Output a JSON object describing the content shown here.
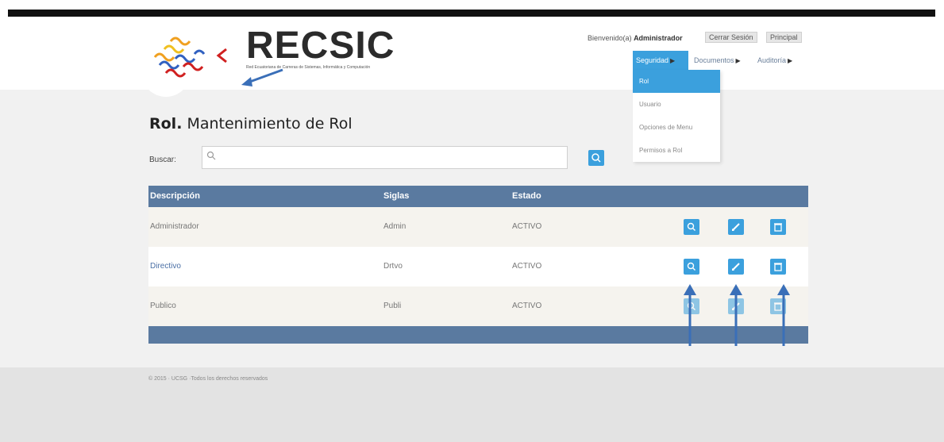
{
  "header": {
    "logo_title": "RECSIC",
    "logo_subtitle": "Red Ecuatoriana de Carreras de Sistemas, Informática y Computación",
    "welcome_text": "Bienvenido(a)",
    "user_name": "Administrador",
    "logout_label": "Cerrar Sesión",
    "home_label": "Principal"
  },
  "nav": {
    "items": [
      {
        "label": "Seguridad",
        "active": true
      },
      {
        "label": "Documentos",
        "active": false
      },
      {
        "label": "Auditoría",
        "active": false
      }
    ],
    "dropdown": [
      {
        "label": "Rol",
        "active": true
      },
      {
        "label": "Usuario",
        "active": false
      },
      {
        "label": "Opciones de Menu",
        "active": false
      },
      {
        "label": "Permisos a Rol",
        "active": false
      }
    ]
  },
  "page": {
    "title_bold": "Rol.",
    "title_rest": "Mantenimiento de Rol",
    "search_label": "Buscar:",
    "search_placeholder": ""
  },
  "table": {
    "columns": [
      "Descripción",
      "Siglas",
      "Estado"
    ],
    "rows": [
      {
        "descripcion": "Administrador",
        "siglas": "Admin",
        "estado": "ACTIVO"
      },
      {
        "descripcion": "Directivo",
        "siglas": "Drtvo",
        "estado": "ACTIVO"
      },
      {
        "descripcion": "Publico",
        "siglas": "Publi",
        "estado": "ACTIVO"
      }
    ]
  },
  "footer": {
    "text": "© 2015 · UCSG ·Todos los derechos reservados"
  },
  "colors": {
    "accent": "#3ba0dd",
    "table_header": "#5a7aa0",
    "annotation_arrow": "#3a6fb8"
  },
  "icons": {
    "search": "search-icon",
    "view": "view-icon",
    "edit": "edit-icon",
    "delete": "delete-icon",
    "submenu": "triangle-right-icon"
  }
}
